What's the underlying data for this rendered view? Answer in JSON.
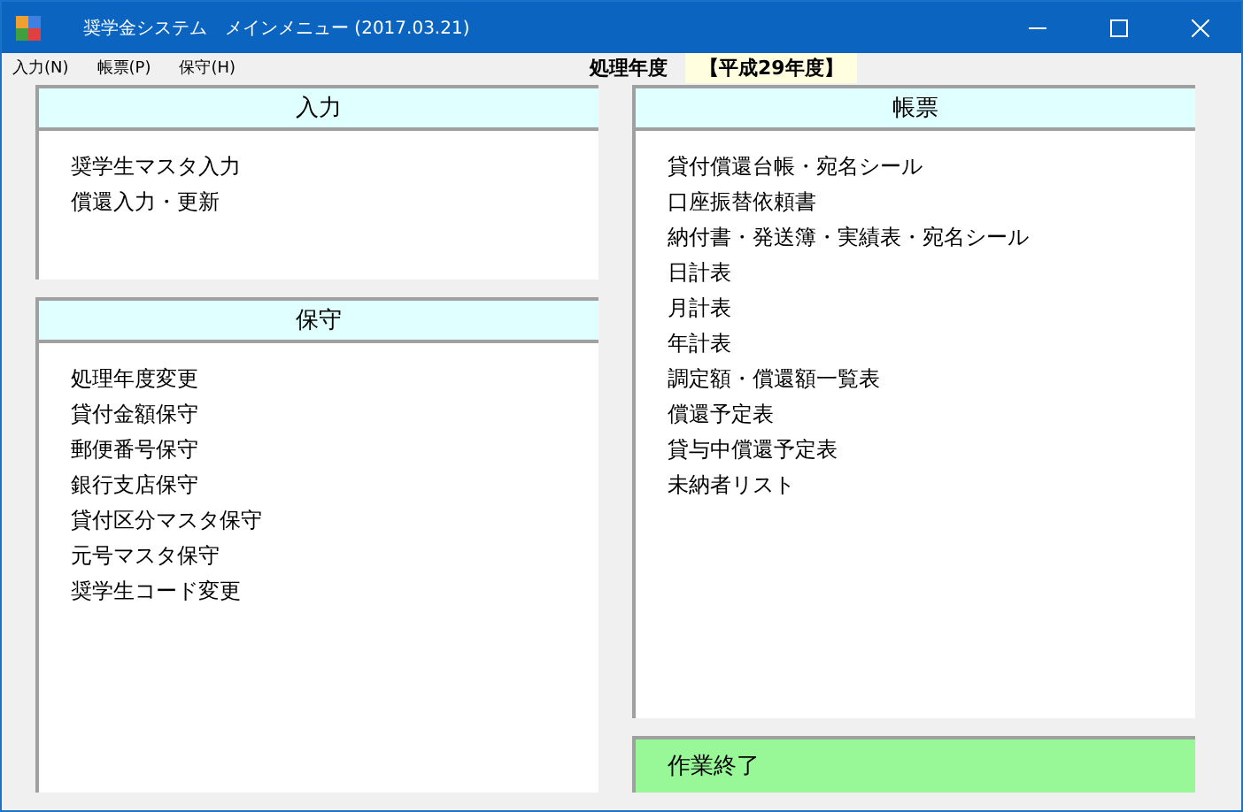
{
  "window": {
    "title": "奨学金システム　メインメニュー (2017.03.21)"
  },
  "menu": [
    "入力(N)",
    "帳票(P)",
    "保守(H)"
  ],
  "fiscal_year": {
    "label": "処理年度",
    "value": "【平成29年度】"
  },
  "panels": [
    {
      "title": "入力",
      "items": [
        "奨学生マスタ入力",
        "償還入力・更新"
      ]
    },
    {
      "title": "保守",
      "items": [
        "処理年度変更",
        "貸付金額保守",
        "郵便番号保守",
        "銀行支店保守",
        "貸付区分マスタ保守",
        "元号マスタ保守",
        "奨学生コード変更"
      ]
    },
    {
      "title": "帳票",
      "items": [
        "貸付償還台帳・宛名シール",
        "口座振替依頼書",
        "納付書・発送簿・実績表・宛名シール",
        "日計表",
        "月計表",
        "年計表",
        "調定額・償還額一覧表",
        "償還予定表",
        "貸与中償還予定表",
        "未納者リスト"
      ]
    }
  ],
  "exit_button": "作業終了"
}
